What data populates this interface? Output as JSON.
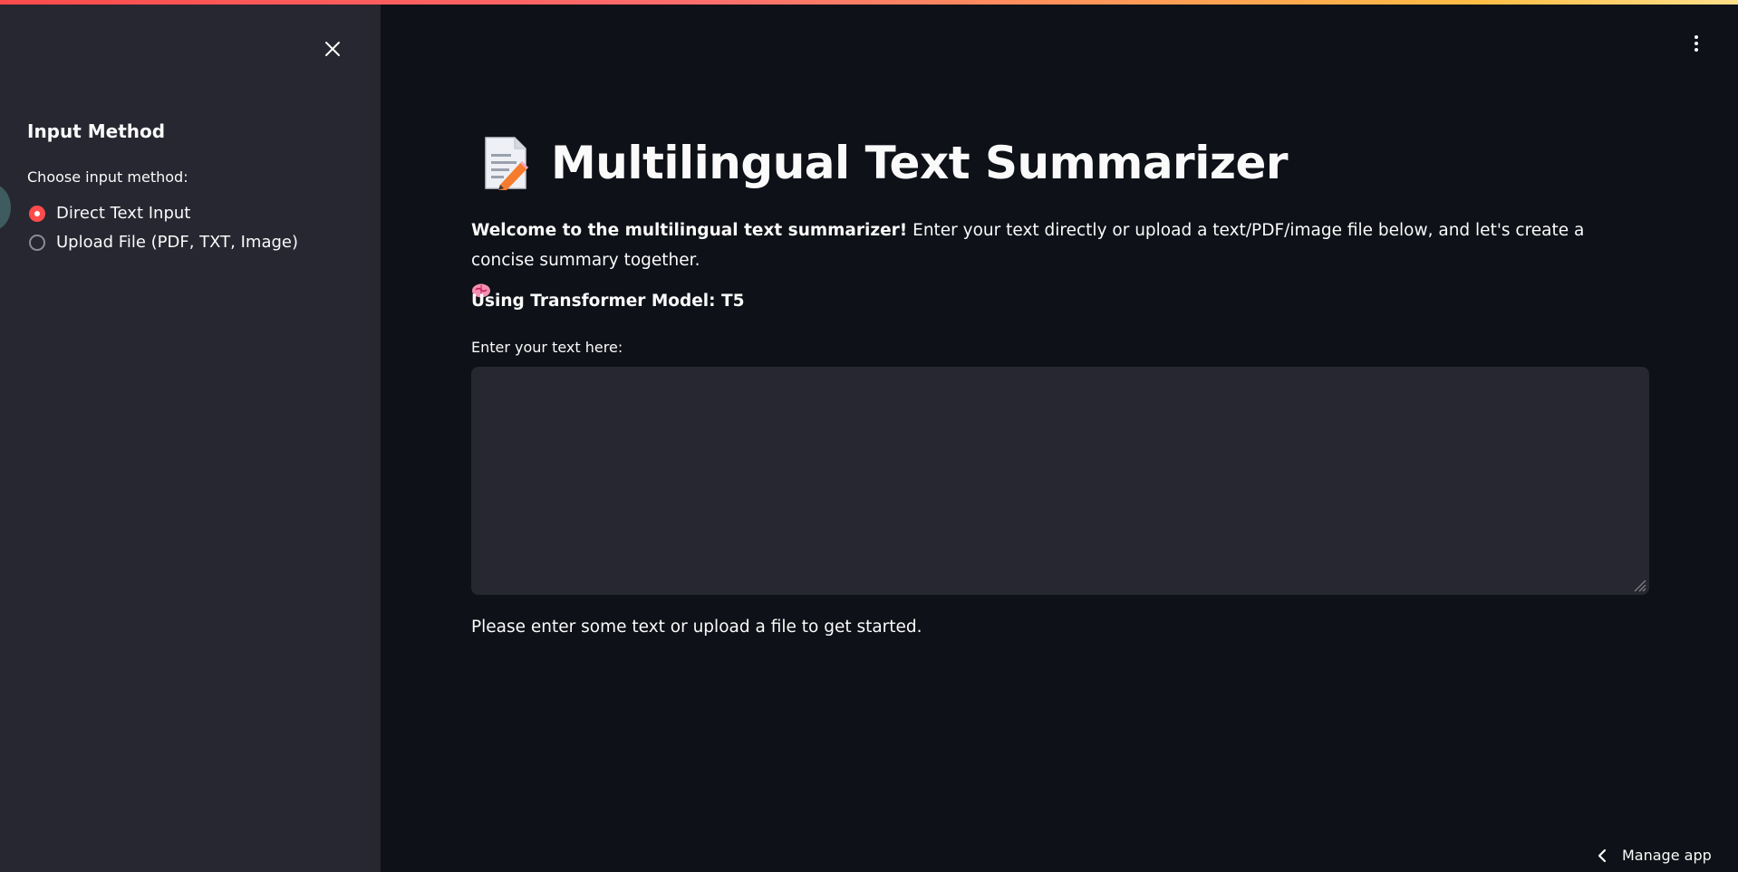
{
  "sidebar": {
    "heading": "Input Method",
    "radio_label": "Choose input method:",
    "options": [
      {
        "label": "Direct Text Input",
        "selected": true
      },
      {
        "label": "Upload File (PDF, TXT, Image)",
        "selected": false
      }
    ]
  },
  "main": {
    "title": "Multilingual Text Summarizer",
    "title_icon": "memo-emoji",
    "welcome_bold": "Welcome to the multilingual text summarizer!",
    "welcome_text": " Enter your text directly or upload a text/PDF/image file below, and let's create a concise summary together.",
    "welcome_icon": "brain-emoji",
    "model_line": "Using Transformer Model: T5",
    "textarea_label": "Enter your text here:",
    "textarea_value": "",
    "info_text": "Please enter some text or upload a file to get started."
  },
  "footer": {
    "manage_label": "Manage app"
  },
  "colors": {
    "accent": "#ff4b4b",
    "background": "#0e1117",
    "sidebar": "#262730"
  }
}
